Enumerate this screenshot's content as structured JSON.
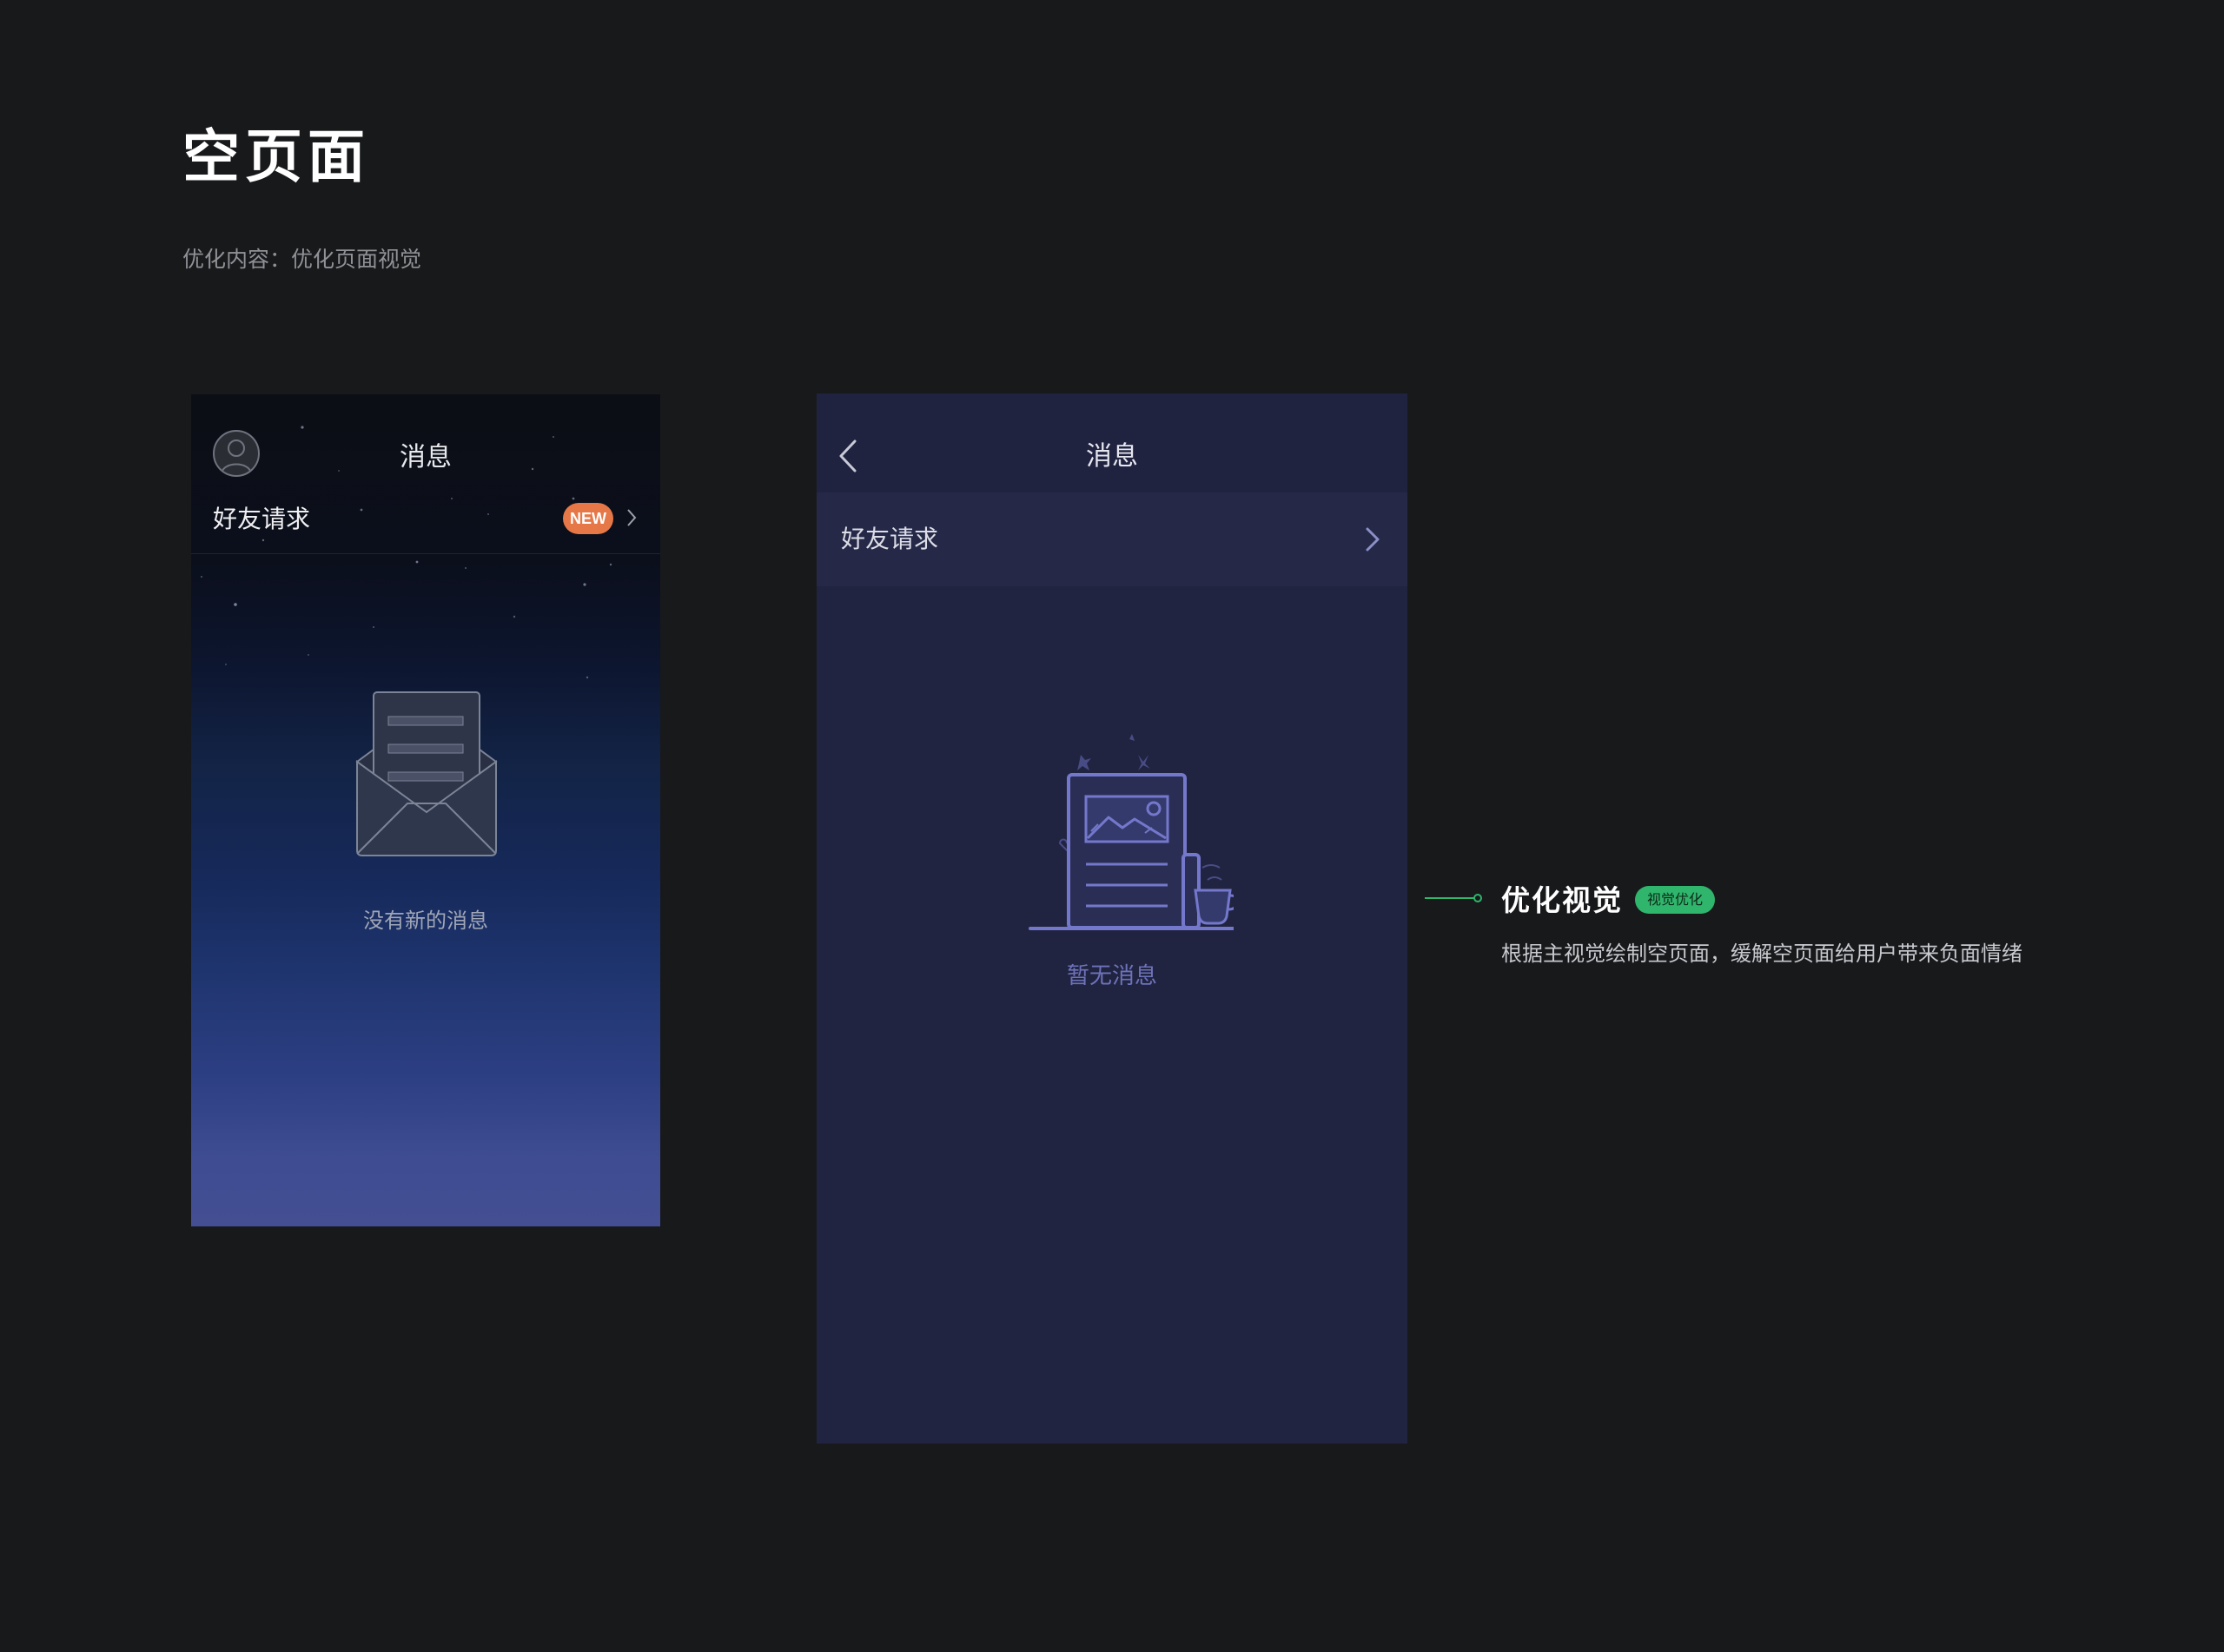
{
  "page": {
    "title": "空页面",
    "subtitle": "优化内容：优化页面视觉"
  },
  "old_screen": {
    "nav_title": "消息",
    "row_label": "好友请求",
    "badge": "NEW",
    "empty_text": "没有新的消息",
    "icons": [
      "avatar-icon",
      "chevron-right-icon",
      "envelope-icon"
    ]
  },
  "new_screen": {
    "nav_title": "消息",
    "row_label": "好友请求",
    "empty_text": "暂无消息",
    "icons": [
      "back-arrow-icon",
      "chevron-right-icon",
      "document-illustration"
    ]
  },
  "annotation": {
    "title": "优化视觉",
    "badge": "视觉优化",
    "description": "根据主视觉绘制空页面，缓解空页面给用户带来负面情绪"
  },
  "colors": {
    "background": "#18191b",
    "new_screen_bg": "#212440",
    "accent_green": "#2fb56c",
    "new_badge": "#e67848",
    "illustration": "#6d72ba"
  }
}
